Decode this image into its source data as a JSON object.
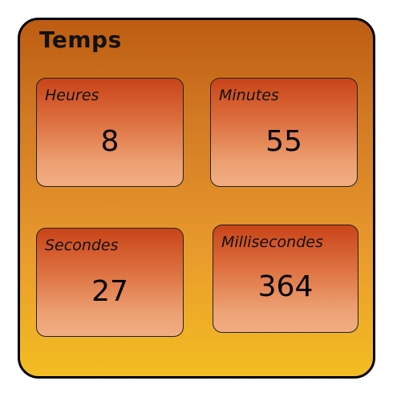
{
  "panel": {
    "title": "Temps"
  },
  "cards": {
    "hours": {
      "label": "Heures",
      "value": "8"
    },
    "minutes": {
      "label": "Minutes",
      "value": "55"
    },
    "seconds": {
      "label": "Secondes",
      "value": "27"
    },
    "milliseconds": {
      "label": "Millisecondes",
      "value": "364"
    }
  },
  "colors": {
    "panel_top": "#bd5c12",
    "panel_bottom": "#f4bd22",
    "card_top": "#c94418",
    "card_bottom": "#f1ad82"
  }
}
